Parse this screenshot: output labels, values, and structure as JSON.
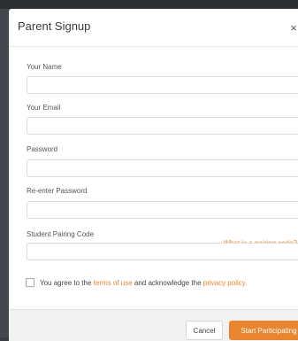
{
  "modal": {
    "title": "Parent Signup",
    "close_glyph": "×"
  },
  "fields": {
    "name": {
      "label": "Your Name",
      "value": ""
    },
    "email": {
      "label": "Your Email",
      "value": ""
    },
    "password": {
      "label": "Password",
      "value": ""
    },
    "reenter_password": {
      "label": "Re-enter Password",
      "value": ""
    },
    "pairing_code": {
      "label": "Student Pairing Code",
      "value": "",
      "help_link": "What is a pairing code?"
    }
  },
  "agreement": {
    "checked": false,
    "prefix": "You agree to the",
    "terms_link": "terms of use",
    "middle": "and acknowledge the",
    "privacy_link": "privacy policy."
  },
  "footer": {
    "cancel_label": "Cancel",
    "submit_label": "Start Participating"
  },
  "colors": {
    "accent": "#e8852e",
    "footer_bg": "#f2f2f2",
    "backdrop": "#3a3d42"
  },
  "icons": {
    "close": "close-icon",
    "checkbox": "checkbox-icon"
  }
}
